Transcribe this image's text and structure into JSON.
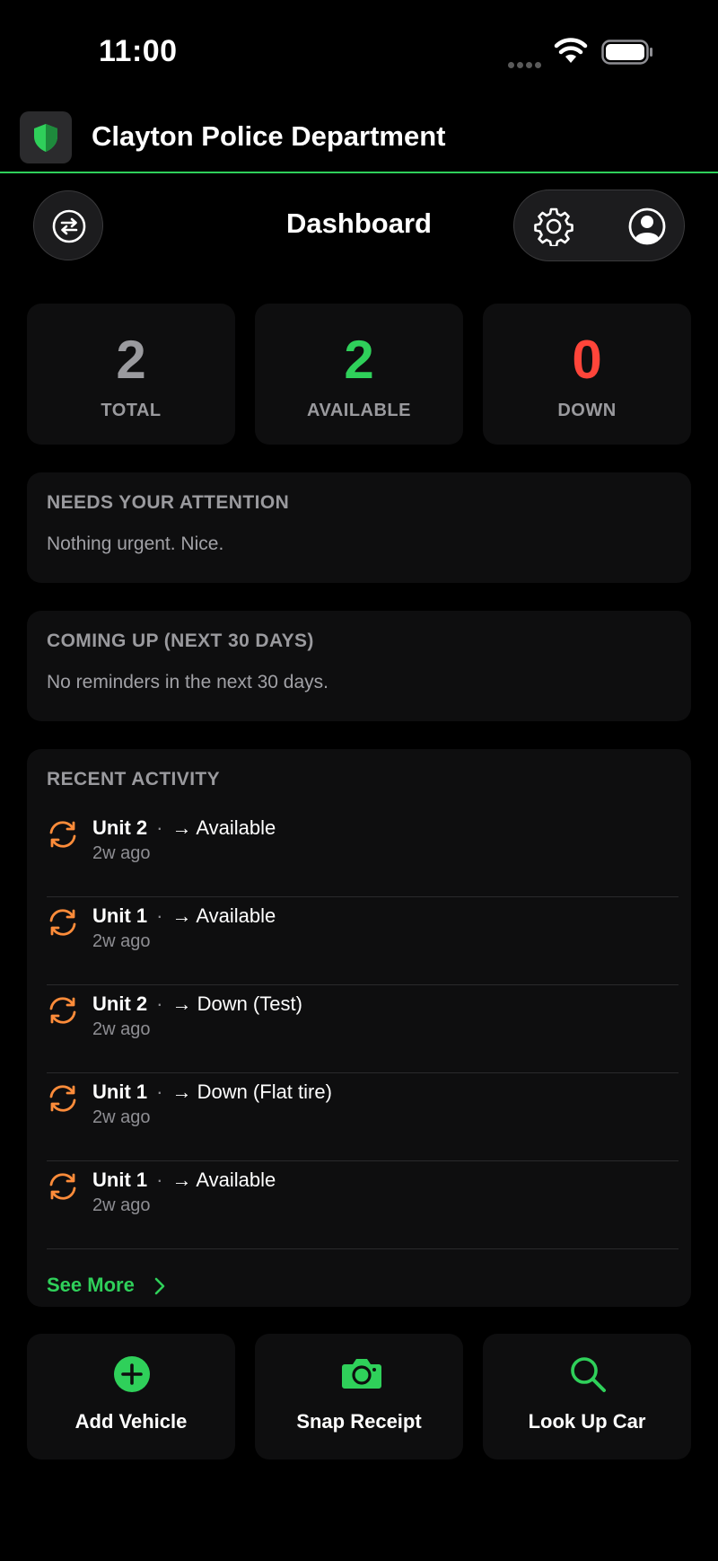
{
  "status_bar": {
    "time": "11:00"
  },
  "header": {
    "org_name": "Clayton Police Department"
  },
  "nav": {
    "title": "Dashboard"
  },
  "stats": [
    {
      "value": "2",
      "label": "TOTAL",
      "color": "#9a9a9e"
    },
    {
      "value": "2",
      "label": "AVAILABLE",
      "color": "#2fd05a"
    },
    {
      "value": "0",
      "label": "DOWN",
      "color": "#ff453a"
    }
  ],
  "attention": {
    "title": "NEEDS YOUR ATTENTION",
    "body": "Nothing urgent. Nice."
  },
  "upcoming": {
    "title": "COMING UP (NEXT 30 DAYS)",
    "body": "No reminders in the next 30 days."
  },
  "activity": {
    "title": "RECENT ACTIVITY",
    "items": [
      {
        "unit": "Unit 2",
        "status": "→ Available",
        "ago": "2w ago"
      },
      {
        "unit": "Unit 1",
        "status": "→ Available",
        "ago": "2w ago"
      },
      {
        "unit": "Unit 2",
        "status": "→ Down (Test)",
        "ago": "2w ago"
      },
      {
        "unit": "Unit 1",
        "status": "→ Down (Flat tire)",
        "ago": "2w ago"
      },
      {
        "unit": "Unit 1",
        "status": "→ Available",
        "ago": "2w ago"
      }
    ],
    "see_more": "See More"
  },
  "actions": [
    {
      "label": "Add Vehicle",
      "icon": "plus-circle-icon"
    },
    {
      "label": "Snap Receipt",
      "icon": "camera-icon"
    },
    {
      "label": "Look Up Car",
      "icon": "search-icon"
    }
  ],
  "colors": {
    "accent": "#2fd05a",
    "danger": "#ff453a",
    "activity_icon": "#ff8c3a"
  },
  "separator": "·"
}
